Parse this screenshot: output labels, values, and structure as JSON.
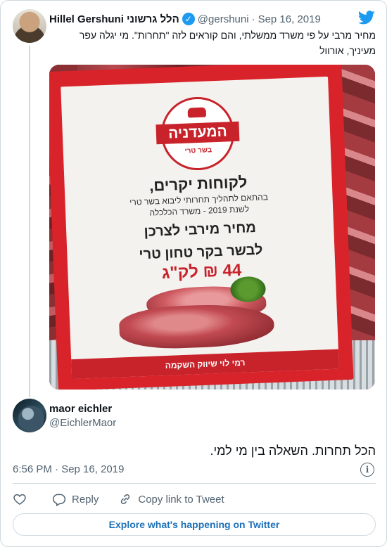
{
  "tweet": {
    "author_name": "Hillel Gershuni הלל גרשוני",
    "handle": "@gershuni",
    "separator": "·",
    "date": "Sep 16, 2019",
    "text": "מחיר מרבי על פי משרד ממשלתי, והם קוראים לזה \"תחרות\". מי יגלה עפר מעיניך, אורוול"
  },
  "image": {
    "logo_name": "המעדניה",
    "logo_sub": "בשר טרי",
    "line1": "לקוחות יקרים,",
    "line2": "בהתאם לתהליך תחרותי ליבוא בשר טרי",
    "line3": "לשנת 2019 - משרד הכלכלה",
    "line4": "מחיר מירבי לצרכן",
    "line5": "לבשר בקר טחון טרי",
    "price": "44 ₪ לק\"ג",
    "footer": "רמי לוי שיווק השקמה"
  },
  "reply": {
    "author_name": "maor eichler",
    "handle": "@EichlerMaor",
    "text": "הכל תחרות. השאלה בין מי למי."
  },
  "meta": {
    "time": "6:56 PM · Sep 16, 2019"
  },
  "actions": {
    "like_label": "",
    "reply_label": "Reply",
    "copy_label": "Copy link to Tweet"
  },
  "footer": {
    "explore_label": "Explore what's happening on Twitter"
  },
  "colors": {
    "accent": "#1d9bf0",
    "text": "#0f1419",
    "muted": "#536471",
    "border": "#cfd9de"
  }
}
